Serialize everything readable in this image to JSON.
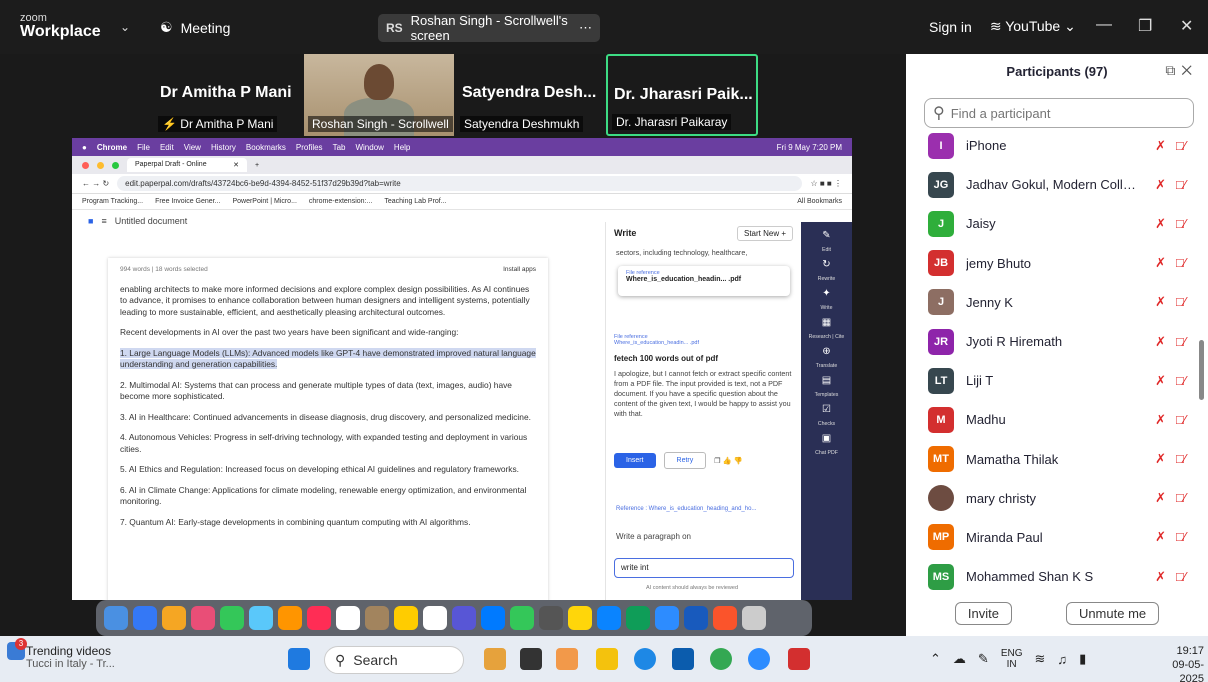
{
  "zoom": {
    "logo_top": "zoom",
    "logo_bottom": "Workplace",
    "meeting_label": "Meeting",
    "share_initials": "RS",
    "share_title": "Roshan Singh - Scrollwell's screen",
    "sign_in": "Sign in",
    "youtube": "YouTube"
  },
  "tiles": [
    {
      "big": "Dr Amitha P Mani",
      "small": "Dr Amitha P Mani"
    },
    {
      "big": "",
      "small": "Roshan Singh - Scrollwell"
    },
    {
      "big": "Satyendra Desh...",
      "small": "Satyendra Deshmukh"
    },
    {
      "big": "Dr. Jharasri Paik...",
      "small": "Dr. Jharasri Paikaray"
    }
  ],
  "mac": {
    "menu": [
      "Chrome",
      "File",
      "Edit",
      "View",
      "History",
      "Bookmarks",
      "Profiles",
      "Tab",
      "Window",
      "Help"
    ],
    "time": "Fri 9 May 7:20 PM"
  },
  "browser": {
    "tab_title": "Paperpal Draft - Online",
    "url": "edit.paperpal.com/drafts/43724bc6-be9d-4394-8452-51f37d29b39d?tab=write",
    "bookmarks": [
      "Program Tracking...",
      "Free Invoice Gener...",
      "PowerPoint | Micro...",
      "chrome-extension:...",
      "Teaching Lab Prof..."
    ],
    "all_bookmarks": "All Bookmarks"
  },
  "doc": {
    "title": "Untitled document",
    "word_count": "994 words | 18 words selected",
    "install": "Install apps",
    "paragraphs": [
      "enabling architects to make more informed decisions and explore complex design possibilities. As AI continues to advance, it promises to enhance collaboration between human designers and intelligent systems, potentially leading to more sustainable, efficient, and aesthetically pleasing architectural outcomes.",
      "Recent developments in AI over the past two years have been significant and wide-ranging:",
      "1. Large Language Models (LLMs): Advanced models like GPT-4 have demonstrated improved natural language understanding and generation capabilities.",
      "2. Multimodal AI: Systems that can process and generate multiple types of data (text, images, audio) have become more sophisticated.",
      "3. AI in Healthcare: Continued advancements in disease diagnosis, drug discovery, and personalized medicine.",
      "4. Autonomous Vehicles: Progress in self-driving technology, with expanded testing and deployment in various cities.",
      "5. AI Ethics and Regulation: Increased focus on developing ethical AI guidelines and regulatory frameworks.",
      "6. AI in Climate Change: Applications for climate modeling, renewable energy optimization, and environmental monitoring.",
      "7. Quantum AI: Early-stage developments in combining quantum computing with AI algorithms."
    ]
  },
  "write": {
    "title": "Write",
    "start_new": "Start New +",
    "top_text": "sectors, including technology, healthcare,",
    "file_ref_label": "File reference",
    "file_ref_name": "Where_is_education_headin... .pdf",
    "file_ref_label2": "File reference",
    "file_ref_name2": "Where_is_education_headin... .pdf",
    "prompt_title": "fetech 100 words out of pdf",
    "response": "I apologize, but I cannot fetch or extract specific content from a PDF file. The input provided is text, not a PDF document. If you have a specific question about the content of the given text, I would be happy to assist you with that.",
    "insert": "Insert",
    "retry": "Retry",
    "reference": "Reference : Where_is_education_heading_and_ho...",
    "suggestion": "Write a paragraph on",
    "input_value": "write int",
    "disclaimer": "AI content should always be reviewed",
    "side": [
      "Edit",
      "Rewrite",
      "Write",
      "Research | Cite",
      "Translate",
      "Templates",
      "Checks",
      "Chat PDF"
    ]
  },
  "participants": {
    "title": "Participants (97)",
    "search_placeholder": "Find a participant",
    "list": [
      {
        "initials": "I",
        "name": "iPhone",
        "color": "#9b2fae"
      },
      {
        "initials": "JG",
        "name": "Jadhav Gokul, Modern College ...",
        "color": "#37474f"
      },
      {
        "initials": "J",
        "name": "Jaisy",
        "color": "#2fae3b"
      },
      {
        "initials": "JB",
        "name": "jemy Bhuto",
        "color": "#d32f2f"
      },
      {
        "initials": "J",
        "name": "Jenny K",
        "color": "#8d6e63"
      },
      {
        "initials": "JR",
        "name": "Jyoti R Hiremath",
        "color": "#8e24aa"
      },
      {
        "initials": "LT",
        "name": "Liji T",
        "color": "#37474f"
      },
      {
        "initials": "M",
        "name": "Madhu",
        "color": "#d32f2f"
      },
      {
        "initials": "MT",
        "name": "Mamatha Thilak",
        "color": "#ef6c00"
      },
      {
        "initials": "",
        "name": "mary christy",
        "color": "#6d4c41"
      },
      {
        "initials": "MP",
        "name": "Miranda Paul",
        "color": "#ef6c00"
      },
      {
        "initials": "MS",
        "name": "Mohammed Shan K S",
        "color": "#2e9d45"
      }
    ],
    "invite": "Invite",
    "unmute": "Unmute me"
  },
  "taskbar": {
    "badge": "3",
    "trend_title": "Trending videos",
    "trend_sub": "Tucci in Italy - Tr...",
    "search": "Search",
    "lang1": "ENG",
    "lang2": "IN",
    "time": "19:17",
    "date": "09-05-2025"
  }
}
